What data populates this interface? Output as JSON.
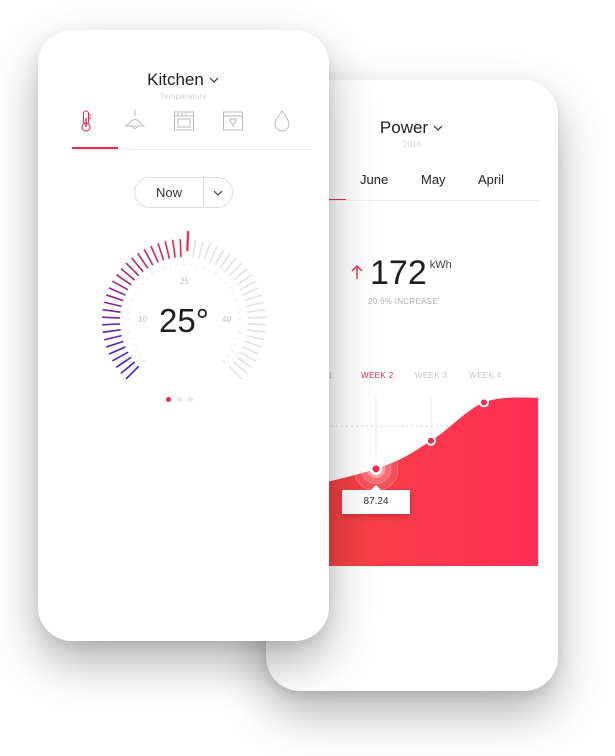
{
  "kitchen": {
    "title": "Kitchen",
    "subtitle": "Temperature",
    "tabs": [
      {
        "icon": "thermometer-icon",
        "active": true
      },
      {
        "icon": "lamp-icon",
        "active": false
      },
      {
        "icon": "oven-icon",
        "active": false
      },
      {
        "icon": "dishwasher-icon",
        "active": false
      },
      {
        "icon": "water-drop-icon",
        "active": false
      }
    ],
    "time_select": {
      "value": "Now"
    },
    "gauge": {
      "value": 25,
      "min": 0,
      "max": 50,
      "tick_labels": [
        "10",
        "25",
        "40"
      ],
      "display": "25°"
    },
    "pager": {
      "pages": 3,
      "active": 0
    }
  },
  "power": {
    "title": "Power",
    "subtitle": "2016",
    "months": [
      "June",
      "May",
      "April"
    ],
    "kpi": {
      "value": "172",
      "unit": "kWh",
      "caption": "20.6% INCREASE"
    },
    "weeks": [
      {
        "label": "1",
        "active": false
      },
      {
        "label": "WEEK 2",
        "active": true
      },
      {
        "label": "WEEK 3",
        "active": false
      },
      {
        "label": "WEEK 4",
        "active": false
      }
    ],
    "tooltip": "87.24"
  },
  "chart_data": {
    "type": "area",
    "x": [
      "WEEK 1",
      "WEEK 2",
      "WEEK 3",
      "WEEK 4"
    ],
    "values": [
      78,
      87.24,
      96,
      108
    ],
    "highlight": {
      "x": "WEEK 2",
      "value": 87.24
    },
    "color_start": "#f0284a",
    "color_end": "#ff2d55"
  },
  "colors": {
    "accent": "#f0284a",
    "gauge_cold": "#3b1fd6",
    "gauge_hot": "#f0284a",
    "inactive_tick": "#e2e2e2"
  }
}
